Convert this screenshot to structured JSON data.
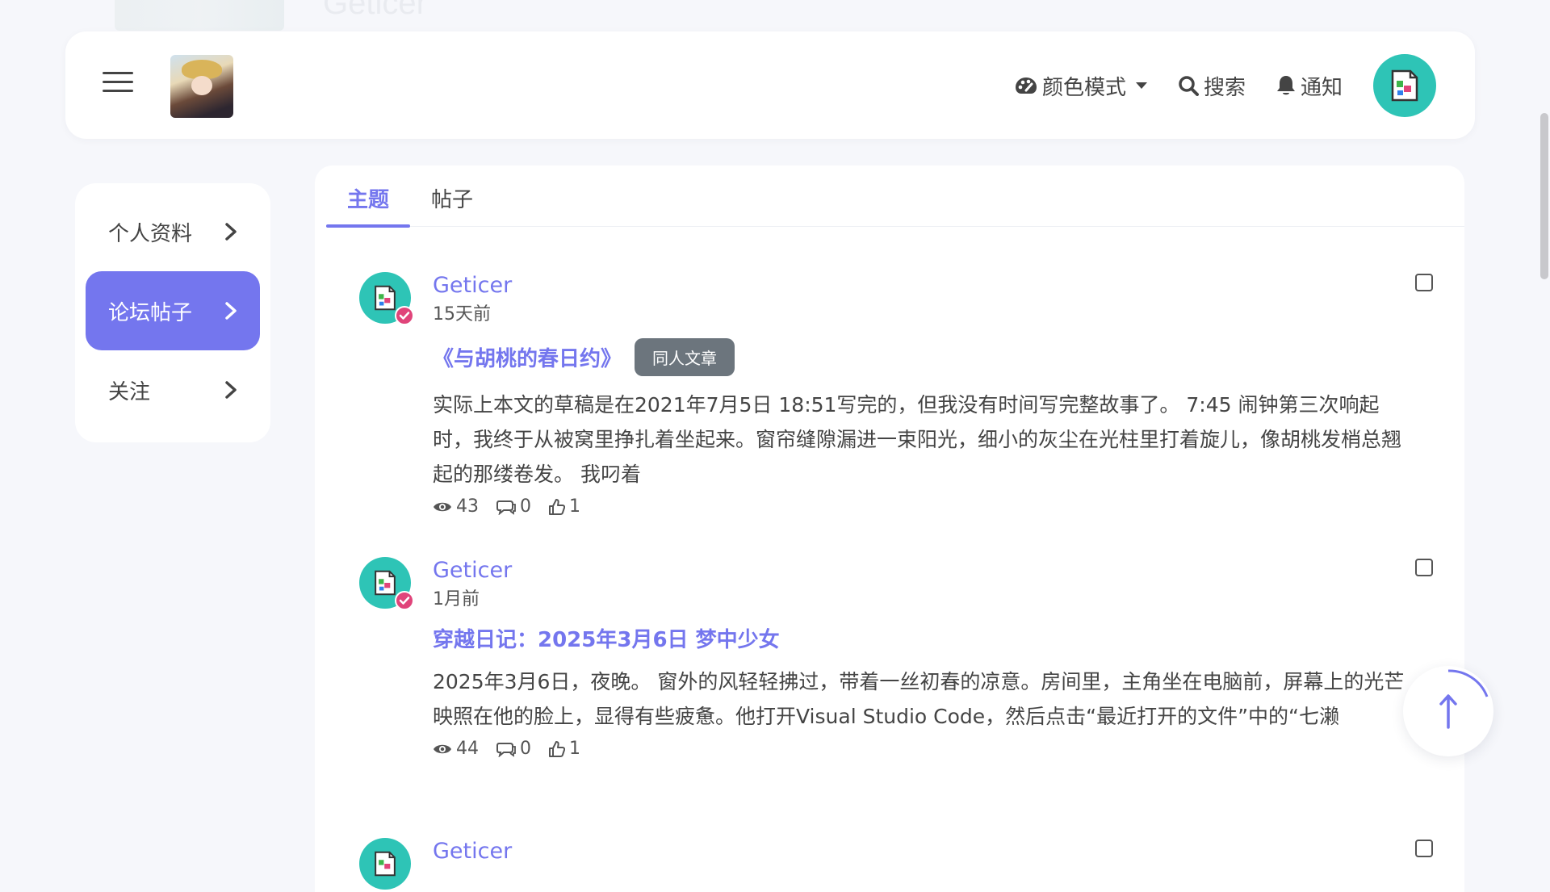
{
  "background": {
    "faint_name": "Geticer"
  },
  "navbar": {
    "color_mode_label": "颜色模式",
    "search_label": "搜索",
    "notify_label": "通知"
  },
  "sidebar": {
    "items": [
      {
        "label": "个人资料"
      },
      {
        "label": "论坛帖子"
      },
      {
        "label": "关注"
      }
    ]
  },
  "tabs": [
    {
      "label": "主题"
    },
    {
      "label": "帖子"
    }
  ],
  "posts": [
    {
      "author": "Geticer",
      "time": "15天前",
      "title": "《与胡桃的春日约》",
      "tag": "同人文章",
      "excerpt": "实际上本文的草稿是在2021年7月5日 18:51写完的，但我没有时间写完整故事了。 7:45 闹钟第三次响起时，我终于从被窝里挣扎着坐起来。窗帘缝隙漏进一束阳光，细小的灰尘在光柱里打着旋儿，像胡桃发梢总翘起的那缕卷发。 我叼着",
      "views": "43",
      "comments": "0",
      "likes": "1"
    },
    {
      "author": "Geticer",
      "time": "1月前",
      "title": "穿越日记：2025年3月6日 梦中少女",
      "tag": "",
      "excerpt": "2025年3月6日，夜晚。 窗外的风轻轻拂过，带着一丝初春的凉意。房间里，主角坐在电脑前，屏幕上的光芒映照在他的脸上，显得有些疲惫。他打开Visual Studio Code，然后点击“最近打开的文件”中的“七濑",
      "views": "44",
      "comments": "0",
      "likes": "1"
    },
    {
      "author": "Geticer"
    }
  ],
  "colors": {
    "accent": "#7476ee",
    "avatar_bg": "#2ec4b6",
    "verified": "#e0447a",
    "tag_bg": "#6c757d"
  }
}
